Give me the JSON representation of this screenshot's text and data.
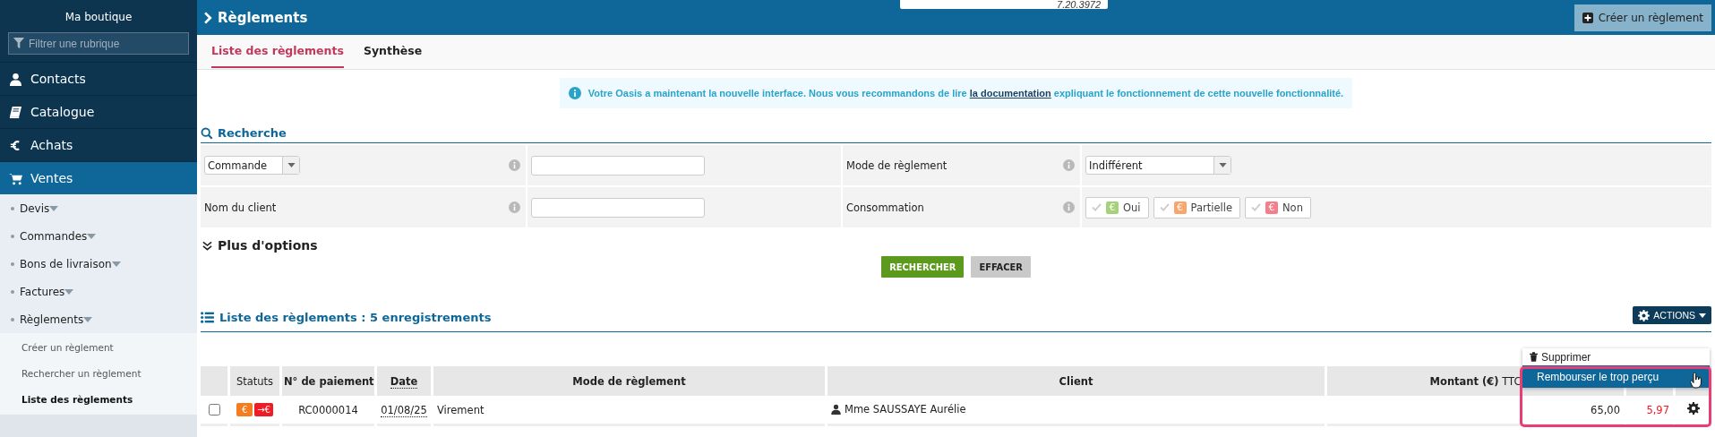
{
  "sidebar": {
    "title": "Ma boutique",
    "filter": {
      "placeholder": "Filtrer une rubrique"
    },
    "items": [
      {
        "label": "Contacts",
        "selected": false
      },
      {
        "label": "Catalogue",
        "selected": false
      },
      {
        "label": "Achats",
        "selected": false
      },
      {
        "label": "Ventes",
        "selected": true,
        "children": [
          {
            "label": "Devis"
          },
          {
            "label": "Commandes"
          },
          {
            "label": "Bons de livraison"
          },
          {
            "label": "Factures"
          },
          {
            "label": "Règlements",
            "children": [
              {
                "label": "Créer un règlement",
                "selected": false
              },
              {
                "label": "Rechercher un règlement",
                "selected": false
              },
              {
                "label": "Liste des règlements",
                "selected": true
              }
            ]
          }
        ]
      }
    ]
  },
  "header": {
    "title": "Règlements",
    "version": "7.20.3972",
    "create_button": "Créer un règlement"
  },
  "tabs": [
    {
      "label": "Liste des règlements",
      "selected": true
    },
    {
      "label": "Synthèse",
      "selected": false
    }
  ],
  "notice": {
    "before": "Votre Oasis a maintenant la nouvelle interface. Nous vous recommandons de lire ",
    "link": "la documentation",
    "after": " expliquant le fonctionnement de cette nouvelle fonctionnalité."
  },
  "search": {
    "title": "Recherche",
    "rows": [
      {
        "criterion": {
          "kind": "select",
          "value": "Commande"
        },
        "field": {
          "kind": "input"
        },
        "label": "Mode de règlement",
        "control": {
          "kind": "select",
          "value": "Indifférent"
        }
      },
      {
        "criterion": {
          "kind": "label",
          "value": "Nom du client"
        },
        "field": {
          "kind": "input"
        },
        "label": "Consommation",
        "control": {
          "kind": "toggles",
          "options": [
            {
              "symbol": "€",
              "label": "Oui",
              "color": "#a6d17b",
              "checked": false
            },
            {
              "symbol": "€",
              "label": "Partielle",
              "color": "#f9a66c",
              "checked": false
            },
            {
              "symbol": "€",
              "label": "Non",
              "color": "#f47f8a",
              "checked": false
            }
          ]
        }
      }
    ],
    "more_options": "Plus d'options",
    "buttons": [
      {
        "label": "RECHERCHER",
        "kind": "primary"
      },
      {
        "label": "EFFACER",
        "kind": "secondary"
      }
    ]
  },
  "list": {
    "title": "Liste des règlements : 5 enregistrements",
    "actions_button": "ACTIONS",
    "menu": [
      {
        "label": "Supprimer",
        "selected": false
      },
      {
        "label": "Rembourser le trop perçu",
        "selected": true
      }
    ],
    "columns": [
      {
        "label": "Statuts",
        "bold": false,
        "dotted": false
      },
      {
        "label": "N° de paiement",
        "bold": true,
        "dotted": false
      },
      {
        "label": "Date",
        "bold": true,
        "dotted": true
      },
      {
        "label": "Mode de règlement",
        "bold": true,
        "dotted": false
      },
      {
        "label": "Client",
        "bold": true,
        "dotted": false
      },
      {
        "label": "**Montant (€)** TTC",
        "bold": false,
        "dotted": false
      }
    ],
    "rows": [
      {
        "checked": false,
        "statuses": [
          {
            "label": "€",
            "color": "#f47d20"
          },
          {
            "label": "→€",
            "color": "#ee1c25"
          }
        ],
        "number": "RC0000014",
        "date": "01/08/25",
        "mode": "Virement",
        "client": "Mme SAUSSAYE Aurélie",
        "amount": "65,00",
        "overpaid": "5,97"
      }
    ]
  }
}
